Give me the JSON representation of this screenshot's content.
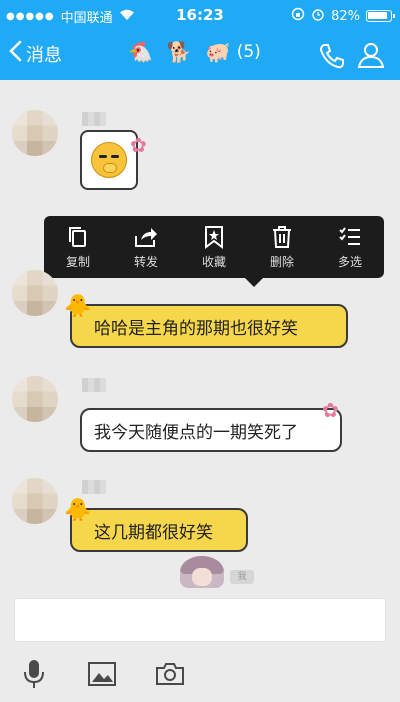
{
  "status_bar": {
    "carrier": "中国联通",
    "time": "16:23",
    "battery": "82%"
  },
  "nav": {
    "back_label": "消息",
    "group_count": "(5)",
    "icons": [
      "chicken-icon",
      "dog-icon",
      "pig-icon",
      "phone-icon",
      "contact-icon"
    ]
  },
  "messages": [
    {
      "from": "other",
      "type": "sticker"
    },
    {
      "from": "other",
      "text": "哈哈是主角的那期也很好笑"
    },
    {
      "from": "other",
      "text": "我今天随便点的一期笑死了"
    },
    {
      "from": "other",
      "text": "这几期都很好笑"
    }
  ],
  "context_menu": {
    "items": [
      {
        "label": "复制",
        "icon": "copy-icon"
      },
      {
        "label": "转发",
        "icon": "forward-icon"
      },
      {
        "label": "收藏",
        "icon": "bookmark-icon"
      },
      {
        "label": "删除",
        "icon": "trash-icon"
      },
      {
        "label": "多选",
        "icon": "multiselect-icon"
      }
    ]
  },
  "self": {
    "badge": "我"
  },
  "toolbar": {
    "icons": [
      "microphone-icon",
      "image-icon",
      "camera-icon"
    ]
  },
  "colors": {
    "header": "#20a9f5",
    "bubble_yellow": "#f6d64b",
    "menu_bg": "#1c1c1c"
  }
}
